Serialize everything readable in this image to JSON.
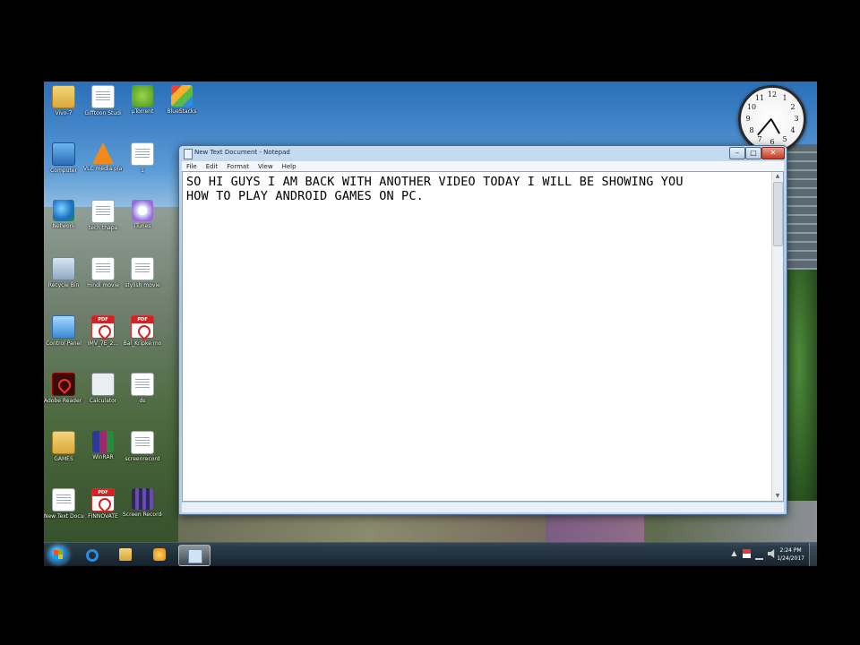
{
  "desktop_icons": [
    {
      "label": "Vivo-7",
      "glyph": "folder-icon"
    },
    {
      "label": "Gifftoon Studi",
      "glyph": "document-icon"
    },
    {
      "label": "µTorrent",
      "glyph": "utorrent-icon"
    },
    {
      "label": "BlueStacks",
      "glyph": "bluestacks-icon"
    },
    {
      "label": "Computer",
      "glyph": "computer-icon"
    },
    {
      "label": "VLC media player",
      "glyph": "vlc-icon"
    },
    {
      "label": "1",
      "glyph": "document-icon"
    },
    {
      "label": "Network",
      "glyph": "globe-icon"
    },
    {
      "label": "tech thapa",
      "glyph": "document-icon"
    },
    {
      "label": "iTunes",
      "glyph": "itunes-icon"
    },
    {
      "label": "Recycle Bin",
      "glyph": "recycle-bin-icon"
    },
    {
      "label": "Hindi movie",
      "glyph": "document-icon"
    },
    {
      "label": "stylish movie",
      "glyph": "document-icon"
    },
    {
      "label": "Control Panel",
      "glyph": "control-panel-icon"
    },
    {
      "label": "IMV_7E_2...",
      "glyph": "pdf-icon"
    },
    {
      "label": "Bal_Kripke mo",
      "glyph": "pdf-icon"
    },
    {
      "label": "Adobe Reader XI",
      "glyph": "acrobat-icon"
    },
    {
      "label": "Calculator",
      "glyph": "calculator-icon"
    },
    {
      "label": "ds",
      "glyph": "document-icon"
    },
    {
      "label": "GAMES",
      "glyph": "folder-icon"
    },
    {
      "label": "WinRAR",
      "glyph": "winrar-icon"
    },
    {
      "label": "screenrecord",
      "glyph": "document-icon"
    },
    {
      "label": "New Text Document",
      "glyph": "document-icon"
    },
    {
      "label": "FINNOVATE",
      "glyph": "pdf-icon"
    },
    {
      "label": "Screen Recorder",
      "glyph": "film-icon"
    }
  ],
  "clock_gadget": {
    "numbers": [
      "12",
      "1",
      "2",
      "3",
      "4",
      "5",
      "6",
      "7",
      "8",
      "9",
      "10",
      "11"
    ]
  },
  "notepad": {
    "title": "New Text Document - Notepad",
    "menu": [
      "File",
      "Edit",
      "Format",
      "View",
      "Help"
    ],
    "buttons": {
      "minimize": "–",
      "maximize": "□",
      "close": "✕"
    },
    "content": "SO HI GUYS I AM BACK WITH ANOTHER VIDEO TODAY I WILL BE SHOWING YOU\nHOW TO PLAY ANDROID GAMES ON PC."
  },
  "taskbar": {
    "pinned": [
      "start-button",
      "internet-explorer-icon",
      "windows-explorer-icon",
      "media-player-icon",
      "notepad-icon"
    ],
    "tray_icons": [
      "tray-expand-icon",
      "action-center-flag-icon",
      "network-icon",
      "volume-icon"
    ],
    "time": "2:24 PM",
    "date": "1/24/2017"
  },
  "colors": {
    "accent": "#2a8ad0",
    "close_button": "#c63a22"
  }
}
